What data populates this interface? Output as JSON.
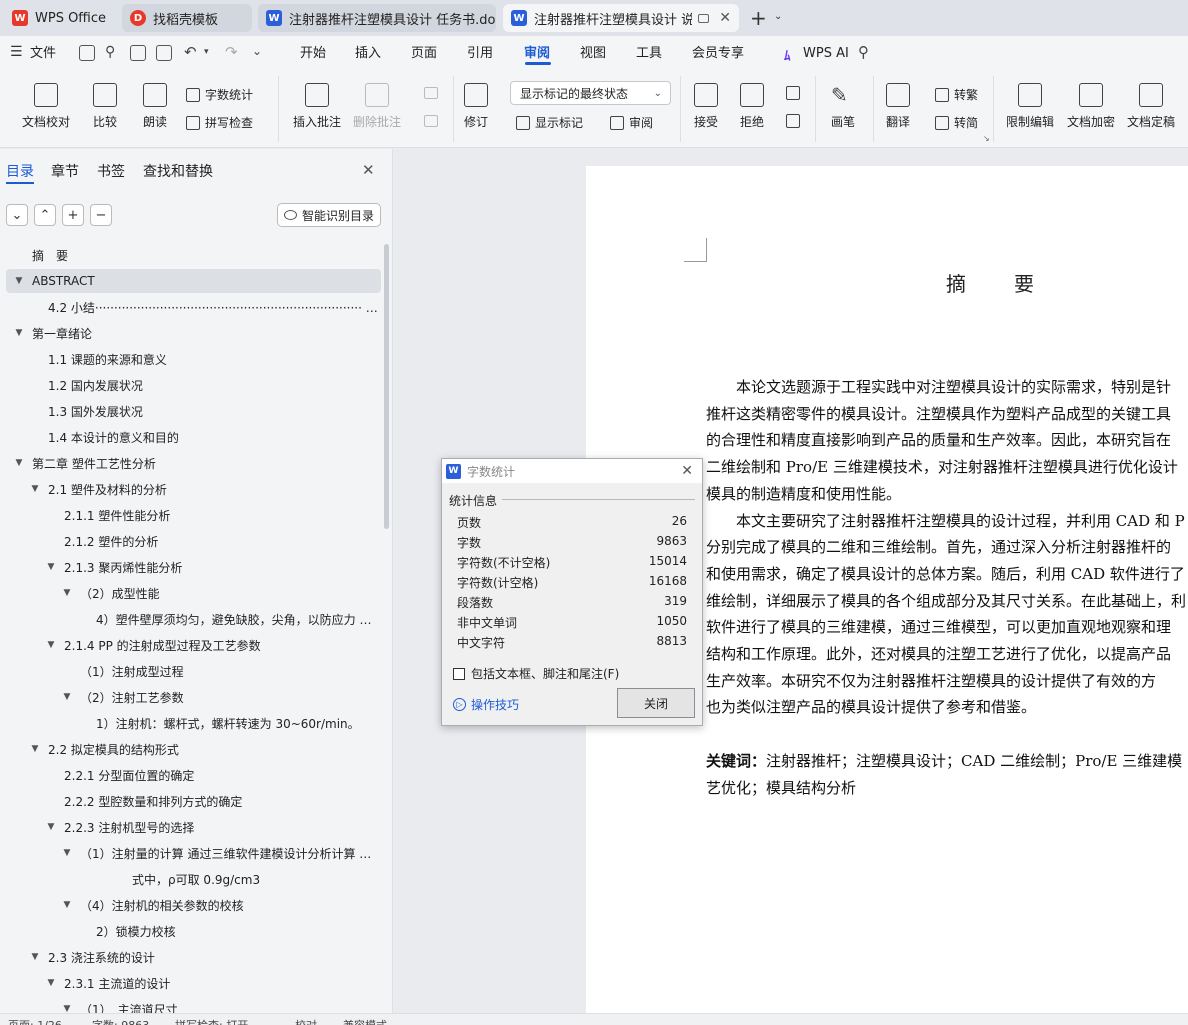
{
  "tabs": [
    {
      "label": "WPS Office",
      "icon": "wps-logo-icon"
    },
    {
      "label": "找稻壳模板",
      "icon": "docer-icon"
    },
    {
      "label": "注射器推杆注塑模具设计 任务书.docx",
      "icon": "word-doc-icon"
    },
    {
      "label": "注射器推杆注塑模具设计 说明",
      "icon": "word-doc-icon"
    }
  ],
  "menubar": {
    "file": "文件",
    "items": [
      "开始",
      "插入",
      "页面",
      "引用",
      "审阅",
      "视图",
      "工具",
      "会员专享"
    ],
    "active": "审阅",
    "ai": "WPS AI"
  },
  "ribbon": {
    "proofread": "文档校对",
    "compare": "比较",
    "read_aloud": "朗读",
    "word_count": "字数统计",
    "spell_check": "拼写检查",
    "insert_comment": "插入批注",
    "delete_comment": "删除批注",
    "revise": "修订",
    "markup_state": "显示标记的最终状态",
    "show_markup": "显示标记",
    "review": "审阅",
    "accept": "接受",
    "reject": "拒绝",
    "pen": "画笔",
    "translate": "翻译",
    "to_traditional": "转繁",
    "to_simplified": "转简",
    "restrict_edit": "限制编辑",
    "encrypt": "文档加密",
    "finalize": "文档定稿"
  },
  "panel": {
    "tabs": [
      "目录",
      "章节",
      "书签",
      "查找和替换"
    ],
    "smart_toc": "智能识别目录",
    "toc": [
      {
        "label": "摘　要",
        "level": 0,
        "arrow": "none"
      },
      {
        "label": "ABSTRACT",
        "level": 0,
        "arrow": "open",
        "selected": true
      },
      {
        "label": "4.2 小结······································································ …",
        "level": 1,
        "arrow": "none"
      },
      {
        "label": "第一章绪论",
        "level": 0,
        "arrow": "open"
      },
      {
        "label": "1.1 课题的来源和意义",
        "level": 1,
        "arrow": "none"
      },
      {
        "label": "1.2 国内发展状况",
        "level": 1,
        "arrow": "none"
      },
      {
        "label": "1.3 国外发展状况",
        "level": 1,
        "arrow": "none"
      },
      {
        "label": "1.4  本设计的意义和目的",
        "level": 1,
        "arrow": "none"
      },
      {
        "label": "第二章  塑件工艺性分析",
        "level": 0,
        "arrow": "open"
      },
      {
        "label": "2.1 塑件及材料的分析",
        "level": 1,
        "arrow": "open"
      },
      {
        "label": "2.1.1 塑件性能分析",
        "level": 2,
        "arrow": "none"
      },
      {
        "label": "2.1.2 塑件的分析",
        "level": 2,
        "arrow": "none"
      },
      {
        "label": "2.1.3 聚丙烯性能分析",
        "level": 2,
        "arrow": "open"
      },
      {
        "label": "（2）成型性能",
        "level": 3,
        "arrow": "open"
      },
      {
        "label": "4）塑件壁厚须均匀，避免缺胶，尖角，以防应力 …",
        "level": 4,
        "arrow": "none"
      },
      {
        "label": "2.1.4 PP 的注射成型过程及工艺参数",
        "level": 2,
        "arrow": "open"
      },
      {
        "label": "（1）注射成型过程",
        "level": 3,
        "arrow": "none"
      },
      {
        "label": "（2）注射工艺参数",
        "level": 3,
        "arrow": "open"
      },
      {
        "label": "1）注射机：螺杆式，螺杆转速为 30~60r/min。",
        "level": 4,
        "arrow": "none"
      },
      {
        "label": "2.2 拟定模具的结构形式",
        "level": 1,
        "arrow": "open"
      },
      {
        "label": "2.2.1 分型面位置的确定",
        "level": 2,
        "arrow": "none"
      },
      {
        "label": "2.2.2 型腔数量和排列方式的确定",
        "level": 2,
        "arrow": "none"
      },
      {
        "label": "2.2.3 注射机型号的选择",
        "level": 2,
        "arrow": "open"
      },
      {
        "label": "（1）注射量的计算  通过三维软件建模设计分析计算 …",
        "level": 3,
        "arrow": "open"
      },
      {
        "label": "式中，ρ可取 0.9g/cm3",
        "level": 5,
        "arrow": "none"
      },
      {
        "label": "（4）注射机的相关参数的校核",
        "level": 3,
        "arrow": "open"
      },
      {
        "label": "2）锁模力校核",
        "level": 4,
        "arrow": "none"
      },
      {
        "label": "2.3 浇注系统的设计",
        "level": 1,
        "arrow": "open"
      },
      {
        "label": "2.3.1 主流道的设计",
        "level": 2,
        "arrow": "open"
      },
      {
        "label": "（1）　主流道尺寸",
        "level": 3,
        "arrow": "open"
      }
    ]
  },
  "document": {
    "title": "摘　要",
    "lines": [
      "　　本论文选题源于工程实践中对注塑模具设计的实际需求，特别是针",
      "推杆这类精密零件的模具设计。注塑模具作为塑料产品成型的关键工具",
      "的合理性和精度直接影响到产品的质量和生产效率。因此，本研究旨在",
      "二维绘制和 Pro/E 三维建模技术，对注射器推杆注塑模具进行优化设计",
      "模具的制造精度和使用性能。",
      "　　本文主要研究了注射器推杆注塑模具的设计过程，并利用 CAD 和 P",
      "分别完成了模具的二维和三维绘制。首先，通过深入分析注射器推杆的",
      "和使用需求，确定了模具设计的总体方案。随后，利用 CAD 软件进行了",
      "维绘制，详细展示了模具的各个组成部分及其尺寸关系。在此基础上，利",
      "软件进行了模具的三维建模，通过三维模型，可以更加直观地观察和理",
      "结构和工作原理。此外，还对模具的注塑工艺进行了优化，以提高产品",
      "生产效率。本研究不仅为注射器推杆注塑模具的设计提供了有效的方",
      "也为类似注塑产品的模具设计提供了参考和借鉴。"
    ],
    "keywords_label": "关键词：",
    "keywords_line1": "注射器推杆；注塑模具设计；CAD 二维绘制；Pro/E 三维建模",
    "keywords_line2": "艺优化；模具结构分析"
  },
  "dialog": {
    "title": "字数统计",
    "section": "统计信息",
    "stats": [
      {
        "label": "页数",
        "value": "26"
      },
      {
        "label": "字数",
        "value": "9863"
      },
      {
        "label": "字符数(不计空格)",
        "value": "15014"
      },
      {
        "label": "字符数(计空格)",
        "value": "16168"
      },
      {
        "label": "段落数",
        "value": "319"
      },
      {
        "label": "非中文单词",
        "value": "1050"
      },
      {
        "label": "中文字符",
        "value": "8813"
      }
    ],
    "checkbox": "包括文本框、脚注和尾注(F)",
    "tips": "操作技巧",
    "close": "关闭"
  },
  "statusbar": {
    "page": "页面: 1/26",
    "words": "字数: 9863",
    "spell": "拼写检查: 打开",
    "proof": "校对",
    "compat": "兼容模式"
  },
  "colors": {
    "accent": "#1b5bd6",
    "wps_red": "#e8382c",
    "word_blue": "#2b5fd9"
  }
}
